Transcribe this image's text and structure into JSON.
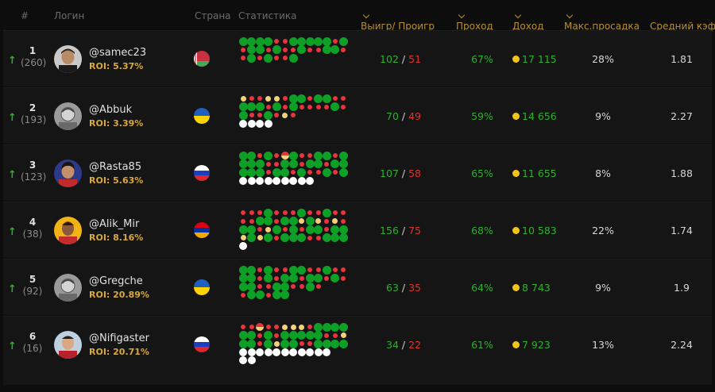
{
  "header": {
    "num": "#",
    "login": "Логин",
    "country": "Страна",
    "stats": "Статистика",
    "winloss": "Выигр/ Проигр",
    "pass": "Проход",
    "income": "Доход",
    "drawdown": "Макс.просадка",
    "coef": "Средний кэф"
  },
  "colors": {
    "win": "#0e9f26",
    "loss": "#e8343a",
    "draw": "#f6d17b",
    "pending": "#ffffff",
    "accent": "#b8902a"
  },
  "rows": [
    {
      "rank": "1",
      "prev": "(260)",
      "trend": "↑",
      "user": "@samec23",
      "roi": "ROI: 5.37%",
      "country": "belarus-flag",
      "stats": [
        "WWWWLLWWWWWLW",
        "LWWLWLLWLLWWL",
        "LWLWLLW"
      ],
      "wins": "102",
      "slash": "/",
      "losses": "51",
      "pass": "67%",
      "income": "17 115",
      "drawdown": "28%",
      "coef": "1.81"
    },
    {
      "rank": "2",
      "prev": "(193)",
      "trend": "↑",
      "user": "@Abbuk",
      "roi": "ROI: 3.39%",
      "country": "ukraine-flag",
      "stats": [
        "DLLDDLWWLWWLL",
        "WWWLWLWLLLLWL",
        "WLLWLDL",
        "PPPP"
      ],
      "wins": "70",
      "slash": "/",
      "losses": "49",
      "pass": "59%",
      "income": "14 656",
      "drawdown": "9%",
      "coef": "2.27"
    },
    {
      "rank": "3",
      "prev": "(123)",
      "trend": "↑",
      "user": "@Rasta85",
      "roi": "ROI: 5.63%",
      "country": "russia-flag",
      "stats": [
        "WWLWLHWLLWWLW",
        "WWWLLWWLWWLWW",
        "WWWLWWLWLLWLW",
        "PPPPPPPPP"
      ],
      "wins": "107",
      "slash": "/",
      "losses": "58",
      "pass": "65%",
      "income": "11 655",
      "drawdown": "8%",
      "coef": "1.88"
    },
    {
      "rank": "4",
      "prev": "(38)",
      "trend": "↑",
      "user": "@Alik_Mir",
      "roi": "ROI: 8.16%",
      "country": "armenia-flag",
      "stats": [
        "LLLWLLLWLLWLL",
        "LLWWLWWDWDLDL",
        "WWLDWLWLWWLWW",
        "DWDWLWWWLLWWW",
        "P"
      ],
      "wins": "156",
      "slash": "/",
      "losses": "75",
      "pass": "68%",
      "income": "10 583",
      "drawdown": "22%",
      "coef": "1.74"
    },
    {
      "rank": "5",
      "prev": "(92)",
      "trend": "↑",
      "user": "@Gregche",
      "roi": "ROI: 20.89%",
      "country": "ukraine-flag",
      "stats": [
        "WWLWLLWWLLWLL",
        "WWLWLWWLWWLWL",
        "WWLLWWLLWL",
        "LWWLWW"
      ],
      "wins": "63",
      "slash": "/",
      "losses": "35",
      "pass": "64%",
      "income": "8 743",
      "drawdown": "9%",
      "coef": "1.9"
    },
    {
      "rank": "6",
      "prev": "(16)",
      "trend": "↑",
      "user": "@Nifigaster",
      "roi": "ROI: 20.71%",
      "country": "russia-flag",
      "stats": [
        "LLHLLDDDLWWWW",
        "WWLWLWWWWWLLD",
        "WWLWDWWLLWWWW",
        "PPPPPPPPPPP",
        "PP"
      ],
      "wins": "34",
      "slash": "/",
      "losses": "22",
      "pass": "61%",
      "income": "7 923",
      "drawdown": "13%",
      "coef": "2.24"
    }
  ]
}
